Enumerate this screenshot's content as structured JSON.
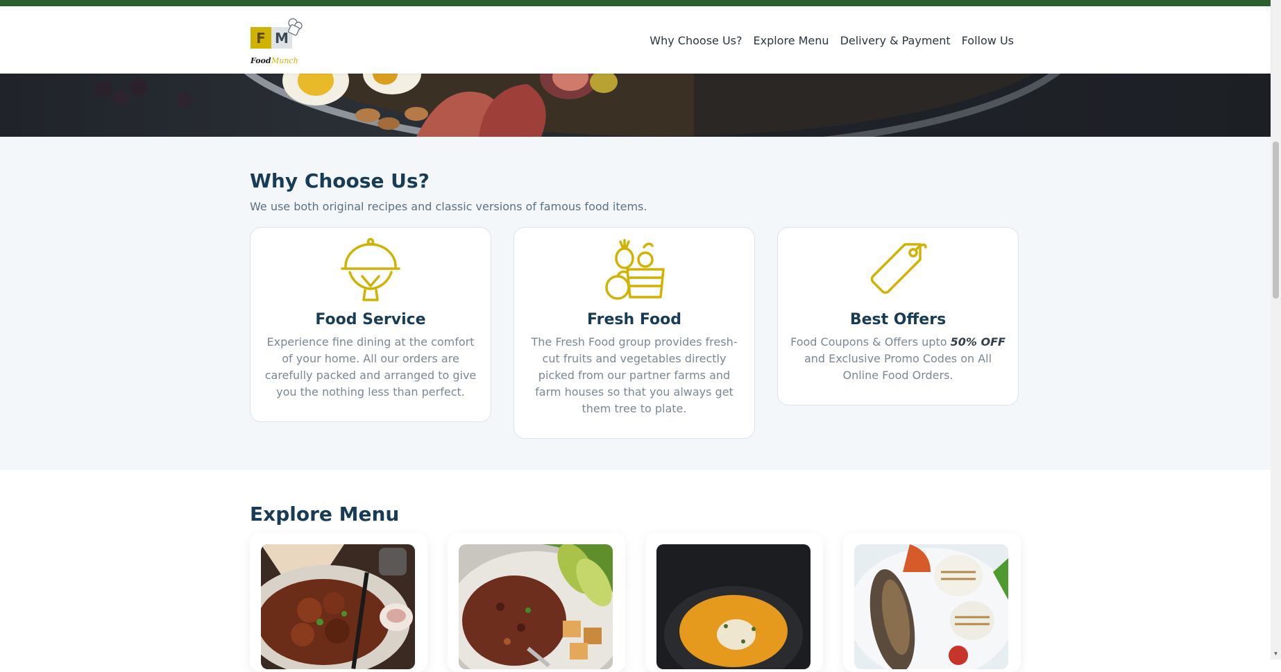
{
  "brand": {
    "logo_letters": [
      "F",
      "M"
    ],
    "name_part1": "Food",
    "name_part2": "Munch",
    "colors": {
      "yellow": "#d0b200",
      "green": "#2d5f2e",
      "navy": "#183b56"
    }
  },
  "nav": {
    "links": [
      "Why Choose Us?",
      "Explore Menu",
      "Delivery & Payment",
      "Follow Us"
    ]
  },
  "why_choose_us": {
    "title": "Why Choose Us?",
    "subtitle": "We use both original recipes and classic versions of famous food items.",
    "cards": [
      {
        "icon": "serving-cloche-icon",
        "title": "Food Service",
        "description": "Experience fine dining at the comfort of your home. All our orders are carefully packed and arranged to give you the nothing less than perfect."
      },
      {
        "icon": "fruit-basket-icon",
        "title": "Fresh Food",
        "description": "The Fresh Food group provides fresh-cut fruits and vegetables directly picked from our partner farms and farm houses so that you always get them tree to plate."
      },
      {
        "icon": "price-tag-icon",
        "title": "Best Offers",
        "description_before": "Food Coupons & Offers upto ",
        "description_highlight": "50% OFF",
        "description_after": " and Exclusive Promo Codes on All Online Food Orders."
      }
    ]
  },
  "explore_menu": {
    "title": "Explore Menu",
    "items": [
      {
        "image": "fried-chicken-photo"
      },
      {
        "image": "grain-bowl-photo"
      },
      {
        "image": "pumpkin-soup-photo"
      },
      {
        "image": "grilled-platter-photo"
      }
    ]
  }
}
